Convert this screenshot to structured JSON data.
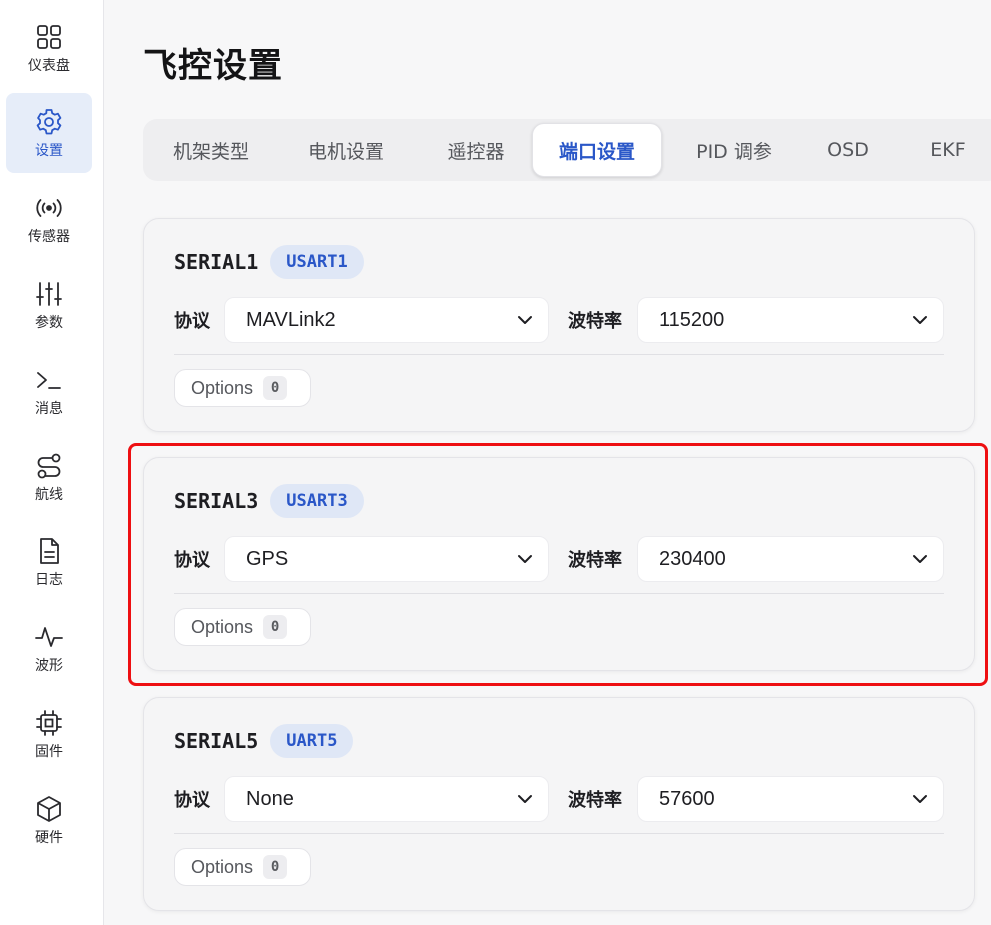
{
  "sidebar": {
    "items": [
      {
        "label": "仪表盘",
        "icon": "dashboard-grid-icon"
      },
      {
        "label": "设置",
        "icon": "gear-icon",
        "active": true
      },
      {
        "label": "传感器",
        "icon": "radio-signal-icon"
      },
      {
        "label": "参数",
        "icon": "sliders-icon"
      },
      {
        "label": "消息",
        "icon": "terminal-icon"
      },
      {
        "label": "航线",
        "icon": "route-icon"
      },
      {
        "label": "日志",
        "icon": "document-icon"
      },
      {
        "label": "波形",
        "icon": "waveform-icon"
      },
      {
        "label": "固件",
        "icon": "chip-icon"
      },
      {
        "label": "硬件",
        "icon": "cube-icon"
      }
    ]
  },
  "page": {
    "title": "飞控设置"
  },
  "tabs": [
    {
      "label": "机架类型"
    },
    {
      "label": "电机设置"
    },
    {
      "label": "遥控器"
    },
    {
      "label": "端口设置",
      "active": true
    },
    {
      "label": "PID 调参"
    },
    {
      "label": "OSD"
    },
    {
      "label": "EKF"
    }
  ],
  "ports": [
    {
      "name": "SERIAL1",
      "badge": "USART1",
      "protocol_label": "协议",
      "protocol": "MAVLink2",
      "baud_label": "波特率",
      "baud": "115200",
      "options_label": "Options",
      "options_count": "0"
    },
    {
      "name": "SERIAL3",
      "badge": "USART3",
      "protocol_label": "协议",
      "protocol": "GPS",
      "baud_label": "波特率",
      "baud": "230400",
      "options_label": "Options",
      "options_count": "0"
    },
    {
      "name": "SERIAL5",
      "badge": "UART5",
      "protocol_label": "协议",
      "protocol": "None",
      "baud_label": "波特率",
      "baud": "57600",
      "options_label": "Options",
      "options_count": "0"
    }
  ],
  "colors": {
    "accent": "#2a57c8",
    "active_bg": "#e6edf9",
    "highlight": "#ee0f12"
  }
}
